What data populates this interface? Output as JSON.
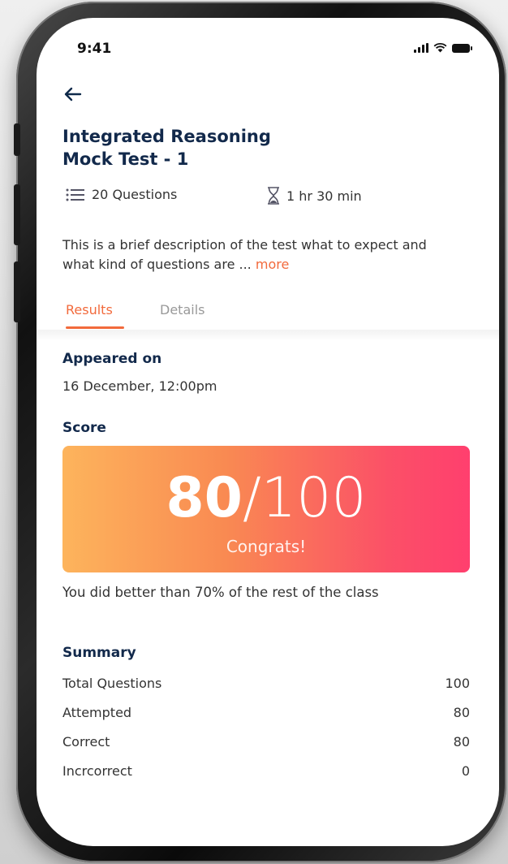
{
  "status_bar": {
    "time": "9:41"
  },
  "test": {
    "title_line1": "Integrated Reasoning",
    "title_line2": "Mock Test - 1",
    "questions": "20 Questions",
    "duration": "1 hr 30 min",
    "description": "This is a brief description of the test what to expect and what kind of questions are ...",
    "more_label": "more"
  },
  "tabs": [
    {
      "label": "Results",
      "active": true
    },
    {
      "label": "Details",
      "active": false
    }
  ],
  "results": {
    "appeared_label": "Appeared on",
    "appeared_value": "16 December, 12:00pm",
    "score_label": "Score",
    "score_value": "80",
    "score_total": "/100",
    "score_message": "Congrats!",
    "comparison_text": "You did better than 70% of the rest of the class"
  },
  "summary": {
    "label": "Summary",
    "rows": [
      {
        "key": "Total Questions",
        "value": "100"
      },
      {
        "key": "Attempted",
        "value": "80"
      },
      {
        "key": "Correct",
        "value": "80"
      },
      {
        "key": "Incrcorrect",
        "value": "0"
      }
    ]
  },
  "colors": {
    "accent": "#f26a3c",
    "title": "#12294b",
    "card_gradient_start": "#fdb45c",
    "card_gradient_end": "#ff3f6e"
  },
  "icons": {
    "back": "arrow-left-icon",
    "questions": "list-icon",
    "duration": "hourglass-icon",
    "signal": "cellular-signal-icon",
    "wifi": "wifi-icon",
    "battery": "battery-icon"
  }
}
